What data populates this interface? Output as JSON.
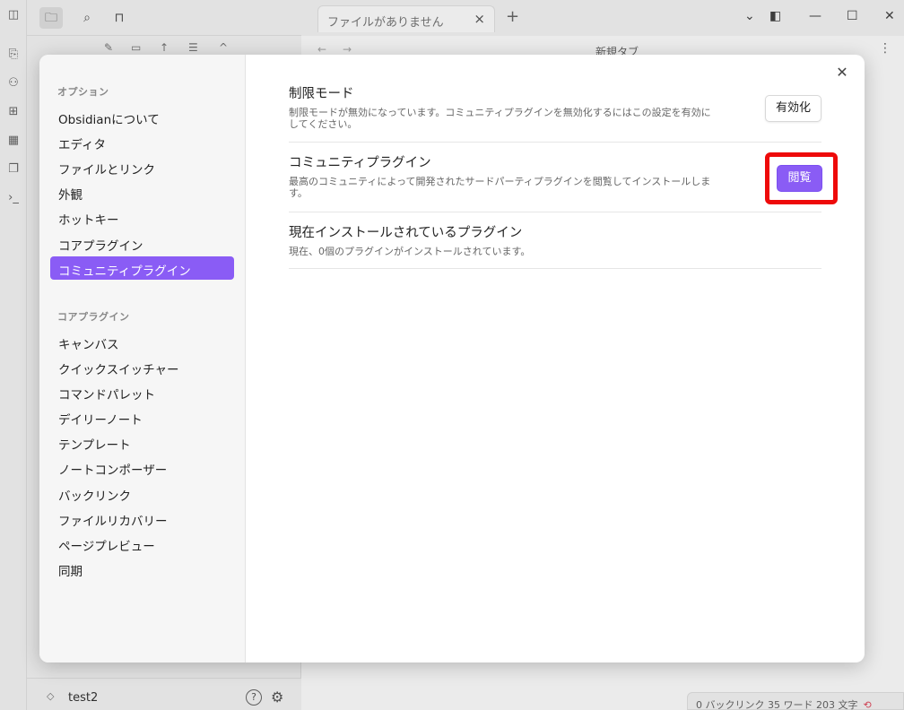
{
  "tabs": {
    "active_label": "ファイルがありません"
  },
  "nav": {
    "title": "新規タブ"
  },
  "vault": {
    "name": "test2"
  },
  "status": {
    "text": "0 バックリンク   35 ワード   203 文字"
  },
  "modal": {
    "sections": [
      {
        "heading": "オプション",
        "items": [
          "Obsidianについて",
          "エディタ",
          "ファイルとリンク",
          "外観",
          "ホットキー",
          "コアプラグイン",
          "コミュニティプラグイン"
        ]
      },
      {
        "heading": "コアプラグイン",
        "items": [
          "キャンバス",
          "クイックスイッチャー",
          "コマンドパレット",
          "デイリーノート",
          "テンプレート",
          "ノートコンポーザー",
          "バックリンク",
          "ファイルリカバリー",
          "ページプレビュー",
          "同期"
        ]
      }
    ],
    "active_item": "コミュニティプラグイン",
    "settings": [
      {
        "name": "制限モード",
        "desc1": "制限モードが無効になっています。コミュニティプラグインを無効化するにはこの設定を有効に",
        "desc2": "してください。",
        "button": "有効化"
      },
      {
        "name": "コミュニティプラグイン",
        "desc1": "最高のコミュニティによって開発されたサードパーティプラグインを閲覧してインストールしま",
        "desc2": "す。",
        "button": "閲覧"
      },
      {
        "name": "現在インストールされているプラグイン",
        "desc1": "現在、0個のプラグインがインストールされています。"
      }
    ]
  },
  "colors": {
    "accent": "#8a5cf5",
    "highlight": "#ee0a0a"
  }
}
